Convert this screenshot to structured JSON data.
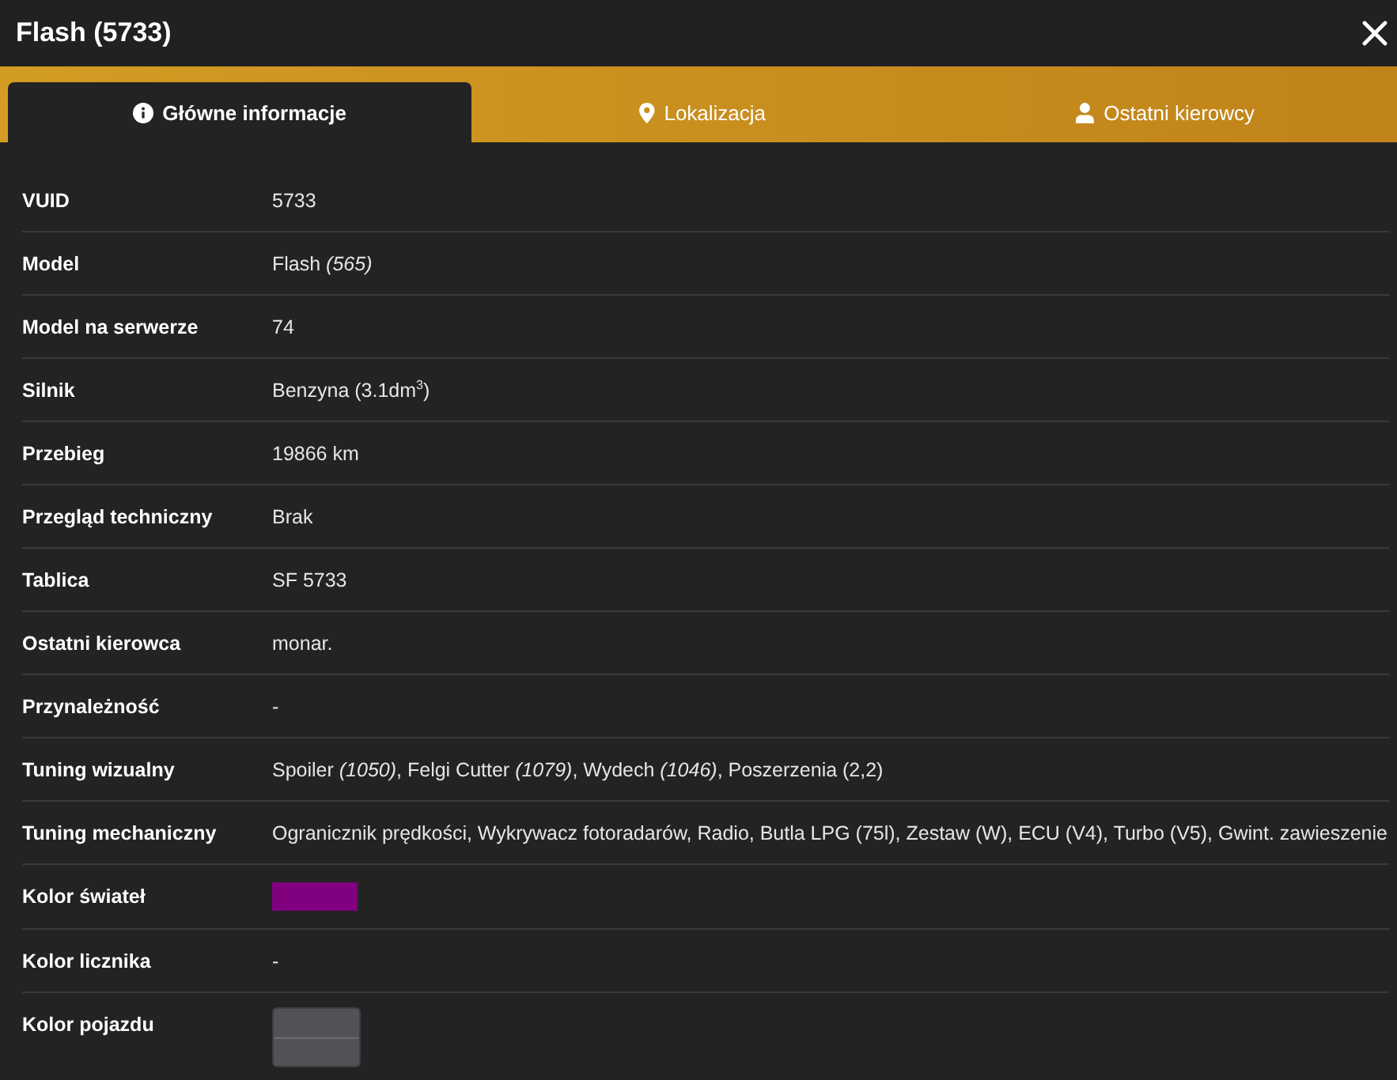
{
  "window": {
    "title": "Flash (5733)"
  },
  "tabs": [
    {
      "label": "Główne informacje",
      "selected": true
    },
    {
      "label": "Lokalizacja",
      "selected": false
    },
    {
      "label": "Ostatni kierowcy",
      "selected": false
    }
  ],
  "rows": [
    {
      "kind": "text",
      "label": "VUID",
      "value": "5733"
    },
    {
      "kind": "text",
      "label": "Model",
      "value": "Flash *(565)*"
    },
    {
      "kind": "text",
      "label": "Model na serwerze",
      "value": "74"
    },
    {
      "kind": "text",
      "label": "Silnik",
      "value": "Benzyna (3.1dm$^{3}$)"
    },
    {
      "kind": "text",
      "label": "Przebieg",
      "value": "19866 km"
    },
    {
      "kind": "text",
      "label": "Przegląd techniczny",
      "value": "Brak"
    },
    {
      "kind": "text",
      "label": "Tablica",
      "value": "SF 5733"
    },
    {
      "kind": "text",
      "label": "Ostatni kierowca",
      "value": "monar."
    },
    {
      "kind": "text",
      "label": "Przynależność",
      "value": "-"
    },
    {
      "kind": "text",
      "label": "Tuning wizualny",
      "value": "Spoiler *(1050)*, Felgi Cutter *(1079)*, Wydech *(1046)*, Poszerzenia (2,2)"
    },
    {
      "kind": "text",
      "label": "Tuning mechaniczny",
      "value": "Ogranicznik prędkości, Wykrywacz fotoradarów, Radio, Butla LPG (75l), Zestaw (W), ECU (V4), Turbo (V5), Gwint. zawieszenie"
    },
    {
      "kind": "color",
      "label": "Kolor świateł",
      "color": "#800080"
    },
    {
      "kind": "text",
      "label": "Kolor licznika",
      "value": "-"
    },
    {
      "kind": "paint",
      "label": "Kolor pojazdu",
      "colors": [
        {
          "color": "#525156"
        },
        {
          "color": "#525156"
        }
      ]
    }
  ]
}
